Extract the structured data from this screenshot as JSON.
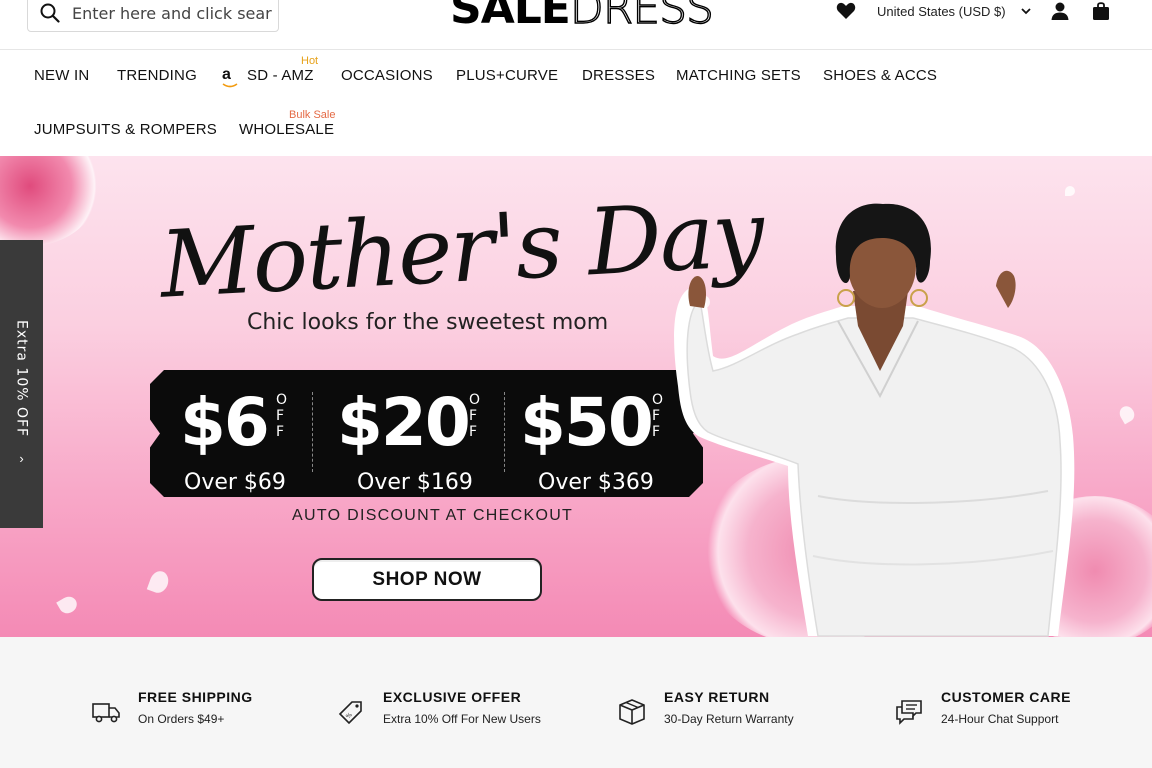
{
  "header": {
    "search_placeholder": "Enter here and click search",
    "logo_part1": "SALE",
    "logo_part2": "DRESS",
    "country": "United States  (USD $)"
  },
  "nav": {
    "items": [
      {
        "label": "NEW IN"
      },
      {
        "label": "TRENDING"
      },
      {
        "label": "SD - AMZ",
        "tag": "Hot"
      },
      {
        "label": "OCCASIONS"
      },
      {
        "label": "PLUS+CURVE"
      },
      {
        "label": "DRESSES"
      },
      {
        "label": "MATCHING SETS"
      },
      {
        "label": "SHOES & ACCS"
      },
      {
        "label": "JUMPSUITS & ROMPERS"
      },
      {
        "label": "WHOLESALE",
        "tag": "Bulk Sale"
      }
    ],
    "amz_letter": "a"
  },
  "hero": {
    "title": "Mother's Day",
    "subtitle": "Chic looks for the sweetest mom",
    "deals": [
      {
        "amount": "$6",
        "off": "OFF",
        "min": "Over $69"
      },
      {
        "amount": "$20",
        "off": "OFF",
        "min": "Over $169"
      },
      {
        "amount": "$50",
        "off": "OFF",
        "min": "Over $369"
      }
    ],
    "auto_discount": "AUTO DISCOUNT AT CHECKOUT",
    "cta": "SHOP NOW"
  },
  "side_tab": {
    "label": "Extra 10% OFF",
    "arrow": "›"
  },
  "features": [
    {
      "title": "FREE SHIPPING",
      "sub": "On Orders $49+",
      "icon": "truck-icon"
    },
    {
      "title": "EXCLUSIVE OFFER",
      "sub": "Extra 10% Off For New Users",
      "icon": "tag-icon"
    },
    {
      "title": "EASY RETURN",
      "sub": "30-Day Return Warranty",
      "icon": "box-icon"
    },
    {
      "title": "CUSTOMER CARE",
      "sub": "24-Hour Chat Support",
      "icon": "chat-icon"
    }
  ],
  "colors": {
    "hot_tag": "#e7a21a",
    "bulk_tag": "#e46a45",
    "hero_pink": "#f48ab5",
    "side_tab": "#3a3a3a"
  }
}
